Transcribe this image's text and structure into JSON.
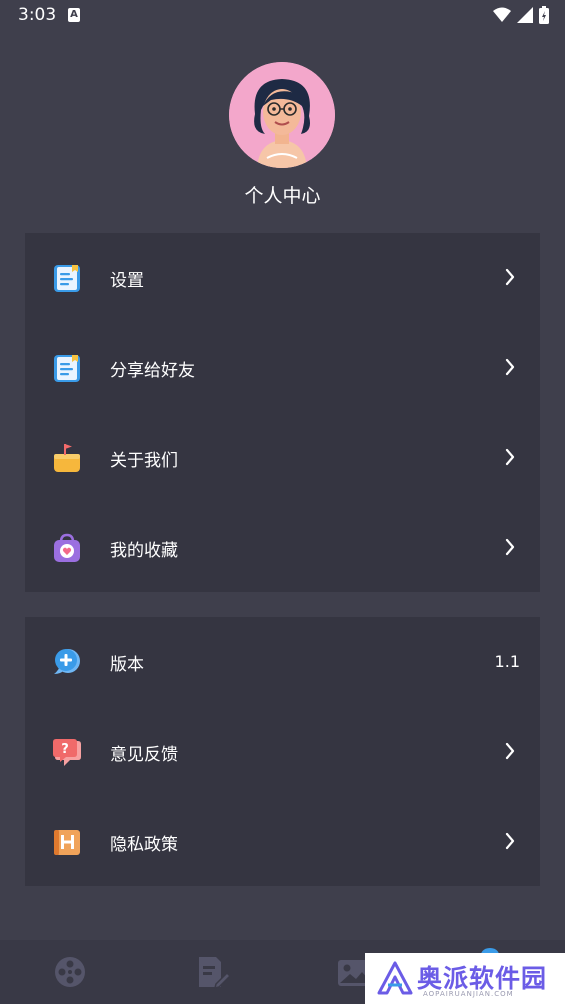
{
  "status_bar": {
    "time": "3:03",
    "notification_badge": "A"
  },
  "profile": {
    "title": "个人中心"
  },
  "menu_group_1": [
    {
      "label": "设置",
      "icon": "notebook-icon"
    },
    {
      "label": "分享给好友",
      "icon": "share-notebook-icon"
    },
    {
      "label": "关于我们",
      "icon": "flag-box-icon"
    },
    {
      "label": "我的收藏",
      "icon": "heart-bag-icon"
    }
  ],
  "menu_group_2": [
    {
      "label": "版本",
      "icon": "chat-plus-icon",
      "value": "1.1"
    },
    {
      "label": "意见反馈",
      "icon": "question-bubble-icon"
    },
    {
      "label": "隐私政策",
      "icon": "policy-scroll-icon"
    }
  ],
  "bottom_nav": [
    "film-reel-icon",
    "edit-document-icon",
    "image-icon",
    "profile-icon"
  ],
  "watermark": {
    "text": "奥派软件园",
    "sub": "AOPAIRUANJIAN.COM"
  },
  "colors": {
    "background": "#3f3f4c",
    "card": "#353541",
    "accent": "#6b5ce6"
  }
}
